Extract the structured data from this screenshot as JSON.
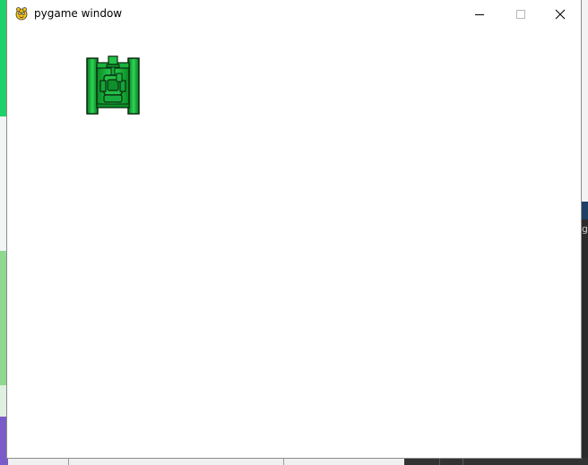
{
  "window": {
    "title": "pygame window",
    "app_icon": "pygame-snake-icon",
    "controls": {
      "minimize_icon": "minimize-icon",
      "maximize_icon": "maximize-icon",
      "close_icon": "close-icon"
    }
  },
  "background_app": {
    "edge_glyph": "g"
  },
  "game": {
    "sprite": "tank-icon",
    "colors": {
      "background": "#ffffff",
      "tank_body": "#0a9a2a",
      "tank_highlight": "#35e05a",
      "tank_outline": "#0b2a10"
    }
  }
}
